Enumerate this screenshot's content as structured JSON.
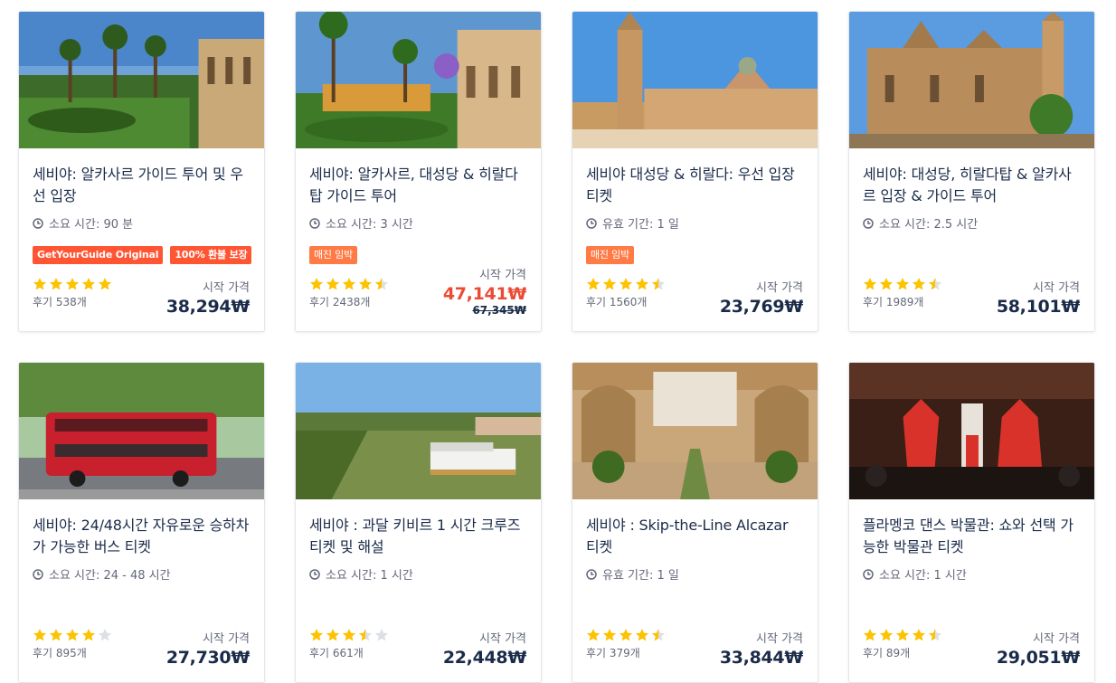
{
  "labels": {
    "from_price": "시작 가격"
  },
  "colors": {
    "star": "#fdc200",
    "star_empty": "#dcdfe4",
    "sale": "#eb4b35",
    "badge_red": "#ff5533",
    "badge_orange": "#ff7a45"
  },
  "cards": [
    {
      "title": "세비야: 알카사르 가이드 투어 및 우선 입장",
      "meta": "소요 시간: 90 분",
      "rating": 5,
      "reviews": "후기 538개",
      "price": "38,294₩",
      "old_price": null,
      "badges": [
        "GetYourGuide Original",
        "100% 환불 보장"
      ]
    },
    {
      "title": "세비야: 알카사르, 대성당 & 히랄다탑 가이드 투어",
      "meta": "소요 시간: 3 시간",
      "rating": 4.5,
      "reviews": "후기 2438개",
      "price": "47,141₩",
      "old_price": "67,345₩",
      "badges": [
        "매진 임박"
      ]
    },
    {
      "title": "세비야 대성당 & 히랄다: 우선 입장 티켓",
      "meta": "유효 기간: 1 일",
      "rating": 4.5,
      "reviews": "후기 1560개",
      "price": "23,769₩",
      "old_price": null,
      "badges": [
        "매진 임박"
      ]
    },
    {
      "title": "세비야: 대성당, 히랄다탑 & 알카사르 입장 & 가이드 투어",
      "meta": "소요 시간: 2.5 시간",
      "rating": 4.5,
      "reviews": "후기 1989개",
      "price": "58,101₩",
      "old_price": null,
      "badges": []
    },
    {
      "title": "세비야: 24/48시간 자유로운 승하차가 가능한 버스 티켓",
      "meta": "소요 시간: 24 - 48 시간",
      "rating": 4,
      "reviews": "후기 895개",
      "price": "27,730₩",
      "old_price": null,
      "badges": []
    },
    {
      "title": "세비야 : 과달 키비르 1 시간 크루즈 티켓 및 해설",
      "meta": "소요 시간: 1 시간",
      "rating": 3.5,
      "reviews": "후기 661개",
      "price": "22,448₩",
      "old_price": null,
      "badges": []
    },
    {
      "title": "세비야 : Skip-the-Line Alcazar 티켓",
      "meta": "유효 기간: 1 일",
      "rating": 4.5,
      "reviews": "후기 379개",
      "price": "33,844₩",
      "old_price": null,
      "badges": []
    },
    {
      "title": "플라멩코 댄스 박물관: 쇼와 선택 가능한 박물관 티켓",
      "meta": "소요 시간: 1 시간",
      "rating": 4.5,
      "reviews": "후기 89개",
      "price": "29,051₩",
      "old_price": null,
      "badges": []
    }
  ]
}
